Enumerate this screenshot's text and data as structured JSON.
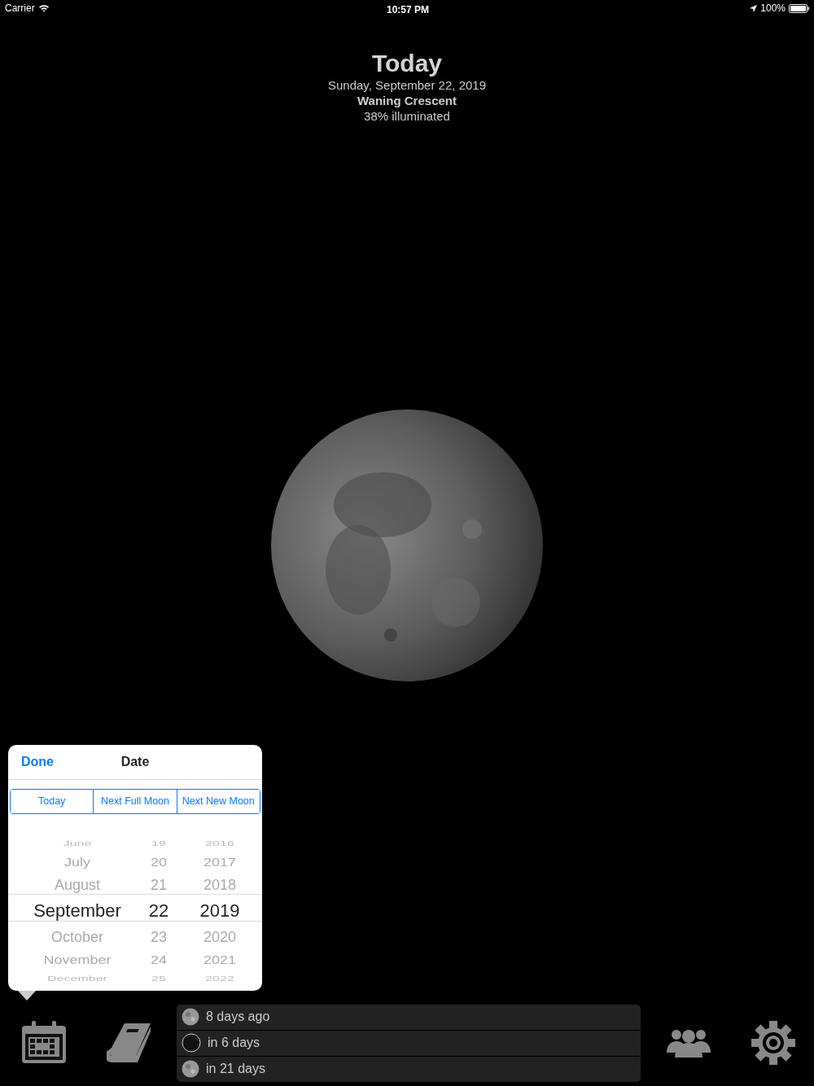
{
  "status_bar": {
    "carrier": "Carrier",
    "time": "10:57 PM",
    "battery": "100%"
  },
  "header": {
    "title": "Today",
    "date": "Sunday, September 22, 2019",
    "phase": "Waning Crescent",
    "illumination": "38% illuminated"
  },
  "date_popover": {
    "done": "Done",
    "title": "Date",
    "segments": [
      {
        "label": "Today",
        "selected": false
      },
      {
        "label": "Next Full Moon",
        "selected": false
      },
      {
        "label": "Next New Moon",
        "selected": false
      }
    ],
    "picker": {
      "months": [
        {
          "label": "June",
          "selected": false
        },
        {
          "label": "July",
          "selected": false
        },
        {
          "label": "August",
          "selected": false
        },
        {
          "label": "September",
          "selected": true
        },
        {
          "label": "October",
          "selected": false
        },
        {
          "label": "November",
          "selected": false
        },
        {
          "label": "December",
          "selected": false
        }
      ],
      "days": [
        {
          "label": "19",
          "selected": false
        },
        {
          "label": "20",
          "selected": false
        },
        {
          "label": "21",
          "selected": false
        },
        {
          "label": "22",
          "selected": true
        },
        {
          "label": "23",
          "selected": false
        },
        {
          "label": "24",
          "selected": false
        },
        {
          "label": "25",
          "selected": false
        }
      ],
      "years": [
        {
          "label": "2016",
          "selected": false
        },
        {
          "label": "2017",
          "selected": false
        },
        {
          "label": "2018",
          "selected": false
        },
        {
          "label": "2019",
          "selected": true
        },
        {
          "label": "2020",
          "selected": false
        },
        {
          "label": "2021",
          "selected": false
        },
        {
          "label": "2022",
          "selected": false
        }
      ]
    }
  },
  "moon_events": [
    {
      "kind": "full",
      "label": "8 days ago"
    },
    {
      "kind": "new",
      "label": "in 6 days"
    },
    {
      "kind": "full",
      "label": "in 21 days"
    }
  ]
}
